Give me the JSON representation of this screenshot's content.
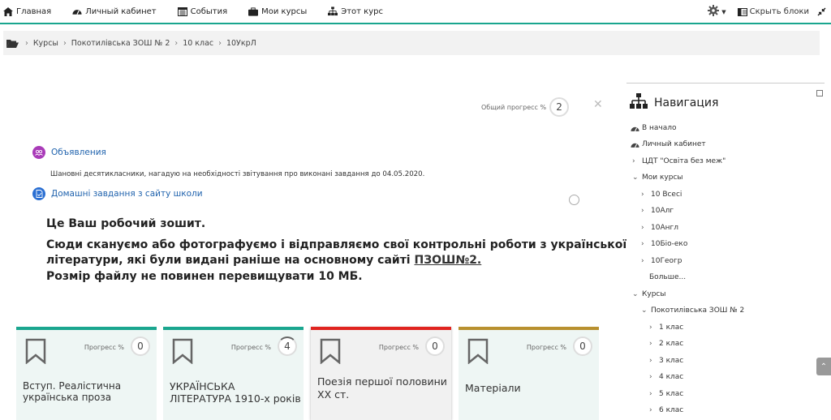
{
  "topnav": {
    "items": [
      {
        "label": "Главная",
        "icon": "home-icon"
      },
      {
        "label": "Личный кабинет",
        "icon": "dashboard-icon"
      },
      {
        "label": "События",
        "icon": "calendar-icon"
      },
      {
        "label": "Мои курсы",
        "icon": "briefcase-icon"
      },
      {
        "label": "Этот курс",
        "icon": "sitemap-icon"
      }
    ],
    "hide_blocks": "Скрыть блоки",
    "accent": "#1aa68f"
  },
  "breadcrumb": {
    "items": [
      "Курсы",
      "Покотилівська ЗОШ № 2",
      "10 клас",
      "10УкрЛ"
    ]
  },
  "overall_progress": {
    "label": "Общий прогресс %",
    "value": "2"
  },
  "announcements": {
    "label": "Объявления"
  },
  "note": "Шановні десятикласники, нагадую на необхідності звітування про виконані завдання до 04.05.2020.",
  "homework": {
    "label": "Домашні завдання з сайту школи"
  },
  "body_text": {
    "line1": "Це Ваш робочий зошит.",
    "line2a": "Сюди скануємо або фотографуємо і відправляємо свої контрольні роботи з української",
    "line2b": "літератури, які були видані раніше на основному сайті ",
    "link": "ПЗОШ№2.",
    "line3": "Розмір файлу не повинен перевищувати 10 МБ."
  },
  "cards": [
    {
      "title1": "Вступ. Реалістична",
      "title2": "українська проза",
      "progress_label": "Прогресс %",
      "progress": "0",
      "color": "#1aa68f"
    },
    {
      "title1": "УКРАЇНСЬКА",
      "title2": "ЛІТЕРАТУРА 1910-х років",
      "progress_label": "Прогресс %",
      "progress": "4",
      "color": "#1aa68f"
    },
    {
      "title1": "Поезія першої половини",
      "title2": "ХХ ст.",
      "progress_label": "Прогресс %",
      "progress": "0",
      "color": "#e0241f"
    },
    {
      "title1": "Матеріали",
      "title2": "",
      "progress_label": "Прогресс %",
      "progress": "0",
      "color": "#b8902f"
    }
  ],
  "navigation": {
    "title": "Навигация",
    "home": "В начало",
    "dashboard": "Личный кабинет",
    "cdt": "ЦДТ \"Освіта без меж\"",
    "my_courses": "Мои курсы",
    "courses_list": [
      "10 Всесі",
      "10Алг",
      "10Англ",
      "10Біо-еко",
      "10Геогр"
    ],
    "more": "Больше...",
    "courses": "Курсы",
    "school": "Покотилівська ЗОШ № 2",
    "grades": [
      "1 клас",
      "2 клас",
      "3 клас",
      "4 клас",
      "5 клас",
      "6 клас"
    ]
  }
}
